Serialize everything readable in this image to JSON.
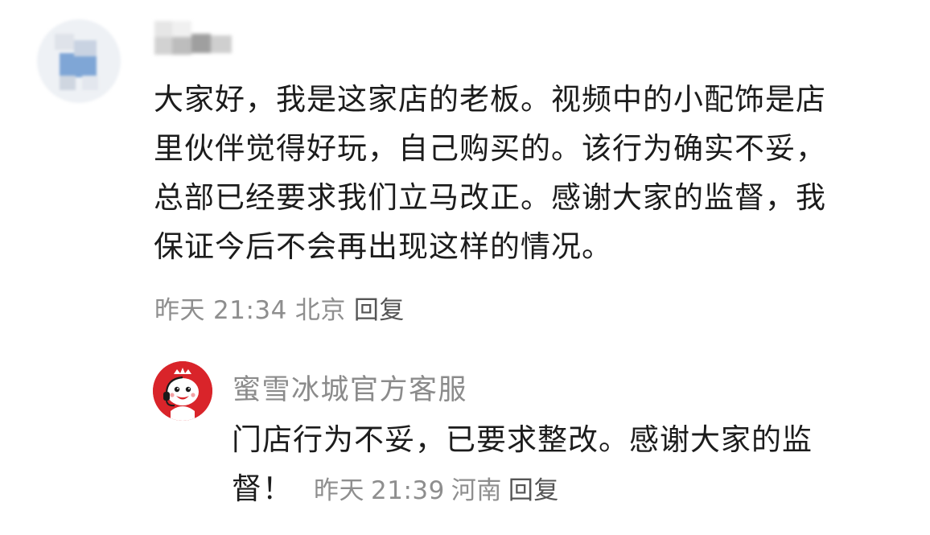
{
  "comment": {
    "author_name": "",
    "lines": [
      "大家好，我是这家店的老板。视频中的小配饰是店",
      "里伙伴觉得好玩，自己购买的。该行为确实不妥，",
      "总部已经要求我们立马改正。感谢大家的监督，我",
      "保证今后不会再出现这样的情况。"
    ],
    "date": "昨天",
    "time": "21:34",
    "location": "北京",
    "reply_label": "回复"
  },
  "reply": {
    "author_name": "蜜雪冰城官方客服",
    "lines": [
      "门店行为不妥，已要求整改。感谢大家的监",
      "督！"
    ],
    "date": "昨天",
    "time": "21:39",
    "location": "河南",
    "reply_label": "回复",
    "avatar_color": "#d9242a"
  },
  "colors": {
    "text": "#1c1c1c",
    "meta": "#8e8e8e",
    "reply_name": "#8b8b8b"
  }
}
